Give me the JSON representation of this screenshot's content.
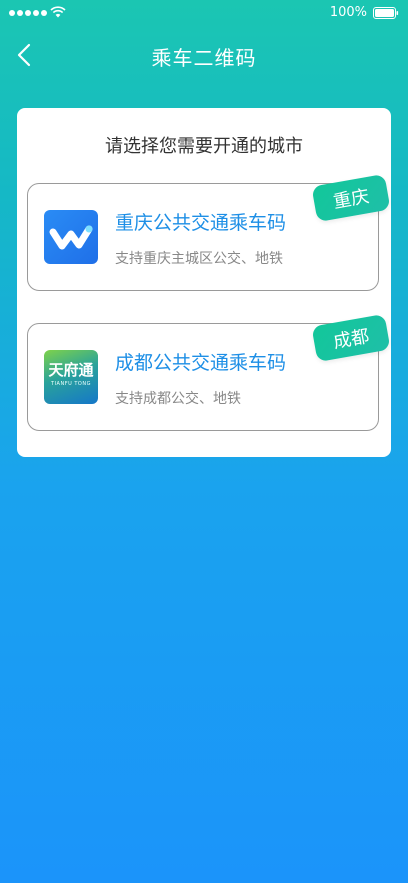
{
  "status_bar": {
    "battery_percent": "100%"
  },
  "nav": {
    "title": "乘车二维码"
  },
  "card": {
    "heading": "请选择您需要开通的城市",
    "options": [
      {
        "title": "重庆公共交通乘车码",
        "desc": "支持重庆主城区公交、地铁",
        "tag": "重庆"
      },
      {
        "title": "成都公共交通乘车码",
        "desc": "支持成都公交、地铁",
        "tag": "成都",
        "logo_text": "天府通",
        "logo_subtext": "TIANFU TONG"
      }
    ]
  },
  "colors": {
    "gradient_top": "#1bc6b2",
    "gradient_bottom": "#1b94fa",
    "accent_blue": "#1e8fe6",
    "tag_green": "#12c79a"
  }
}
